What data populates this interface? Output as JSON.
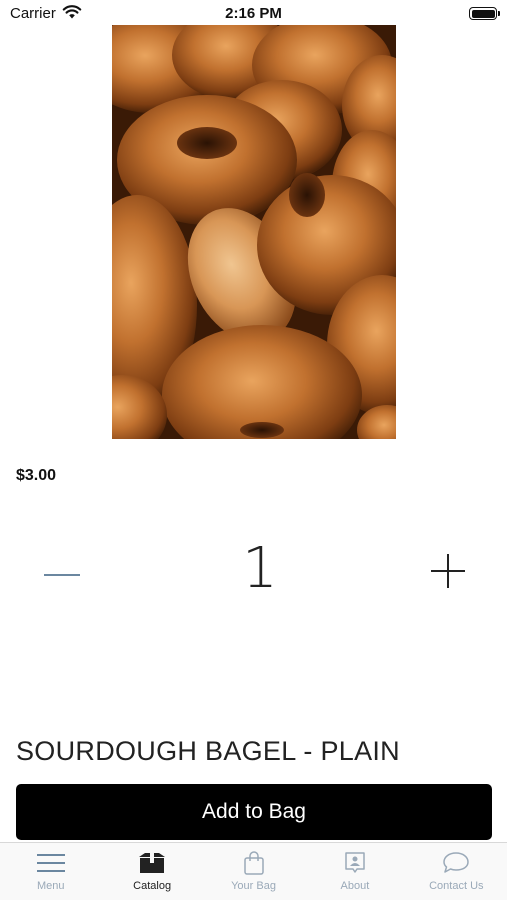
{
  "status_bar": {
    "carrier": "Carrier",
    "time": "2:16 PM"
  },
  "product": {
    "price": "$3.00",
    "name": "SOURDOUGH BAGEL - PLAIN",
    "quantity": "1"
  },
  "actions": {
    "add_to_bag": "Add to Bag"
  },
  "tab_bar": {
    "tabs": [
      {
        "label": "Menu",
        "icon": "menu-icon"
      },
      {
        "label": "Catalog",
        "icon": "catalog-icon",
        "active": true
      },
      {
        "label": "Your Bag",
        "icon": "bag-icon"
      },
      {
        "label": "About",
        "icon": "about-icon"
      },
      {
        "label": "Contact Us",
        "icon": "chat-icon"
      }
    ]
  },
  "colors": {
    "accent": "#000000",
    "tab_inactive": "#9aa9b8",
    "stepper_minus": "#6b87a0"
  }
}
